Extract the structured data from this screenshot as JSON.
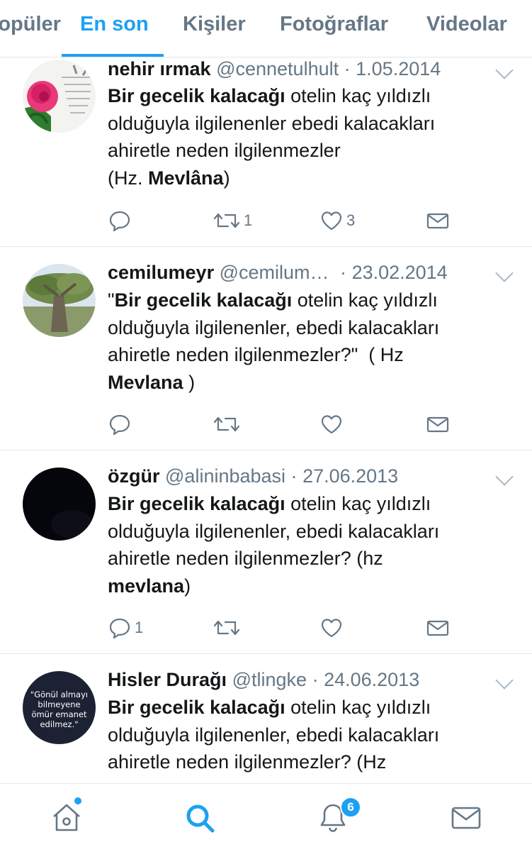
{
  "tabs": [
    {
      "label": "Popüler",
      "active": false
    },
    {
      "label": "En son",
      "active": true
    },
    {
      "label": "Kişiler",
      "active": false
    },
    {
      "label": "Fotoğraflar",
      "active": false
    },
    {
      "label": "Videolar",
      "active": false
    }
  ],
  "tweets": [
    {
      "name": "nehir ırmak",
      "handle": "@cennetulhult",
      "date": "1.05.2014",
      "body_html": "<b>Bir gecelik kalacağı</b> otelin kaç yıldızlı<br>olduğuyla ilgilenenler ebedi kalacakları<br>ahiretle neden ilgilenmezler<br>(Hz. <b>Mevlâna</b>)",
      "reply_count": "",
      "retweet_count": "1",
      "like_count": "3"
    },
    {
      "name": "cemilumeyr",
      "handle": "@cemilum…",
      "date": "23.02.2014",
      "body_html": "\"<b>Bir gecelik kalacağı</b> otelin kaç yıldızlı<br>olduğuyla ilgilenenler, ebedi kalacakları<br>ahiretle neden ilgilenmezler?\"&nbsp;&nbsp;( Hz<br><b>Mevlana</b> )",
      "reply_count": "",
      "retweet_count": "",
      "like_count": ""
    },
    {
      "name": "özgür",
      "handle": "@alininbabasi",
      "date": "27.06.2013",
      "body_html": "<b>Bir gecelik kalacağı</b> otelin kaç yıldızlı<br>olduğuyla ilgilenenler, ebedi kalacakları<br>ahiretle neden ilgilenmezler? (hz<br><b>mevlana</b>)",
      "reply_count": "1",
      "retweet_count": "",
      "like_count": ""
    },
    {
      "name": "Hisler Durağı",
      "handle": "@tlingke",
      "date": "24.06.2013",
      "avatar_text": "\"Gönül almayı bilmeyene ömür emanet edilmez.\"",
      "body_html": "<b>Bir gecelik kalacağı</b> otelin kaç yıldızlı<br>olduğuyla ilgilenenler, ebedi kalacakları<br>ahiretle neden ilgilenmezler? (Hz",
      "reply_count": "",
      "retweet_count": "",
      "like_count": ""
    }
  ],
  "bottom_nav": {
    "notifications_badge": "6"
  },
  "colors": {
    "accent": "#1da1f2",
    "muted": "#657786",
    "divider": "#e1e8ed"
  }
}
